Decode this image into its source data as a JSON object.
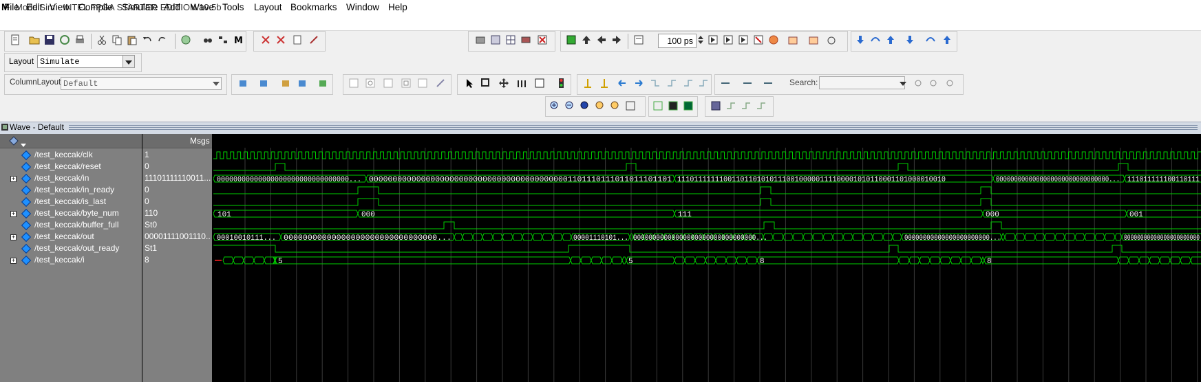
{
  "app": {
    "title": "ModelSim - INTEL FPGA STARTER EDITION 10.5b",
    "logo": "M"
  },
  "menu": [
    "File",
    "Edit",
    "View",
    "Compile",
    "Simulate",
    "Add",
    "Wave",
    "Tools",
    "Layout",
    "Bookmarks",
    "Window",
    "Help"
  ],
  "toolbar": {
    "time_value": "100 ps"
  },
  "layout": {
    "label": "Layout",
    "value": "Simulate"
  },
  "column_layout": {
    "label": "ColumnLayout",
    "value": "Default"
  },
  "search": {
    "label": "Search:"
  },
  "wave_window": {
    "title": "Wave - Default",
    "msgs_header": "Msgs"
  },
  "signals": [
    {
      "name": "/test_keccak/clk",
      "value": "1",
      "expandable": false
    },
    {
      "name": "/test_keccak/reset",
      "value": "0",
      "expandable": false
    },
    {
      "name": "/test_keccak/in",
      "value": "11101111110011...",
      "expandable": true
    },
    {
      "name": "/test_keccak/in_ready",
      "value": "0",
      "expandable": false
    },
    {
      "name": "/test_keccak/is_last",
      "value": "0",
      "expandable": false
    },
    {
      "name": "/test_keccak/byte_num",
      "value": "110",
      "expandable": true
    },
    {
      "name": "/test_keccak/buffer_full",
      "value": "St0",
      "expandable": false
    },
    {
      "name": "/test_keccak/out",
      "value": "00001111001110...",
      "expandable": true
    },
    {
      "name": "/test_keccak/out_ready",
      "value": "St1",
      "expandable": false
    },
    {
      "name": "/test_keccak/i",
      "value": "8",
      "expandable": true
    }
  ],
  "wave_labels": {
    "in": [
      "00000000000000000000000000000000...",
      "0000000000000000000000000000000000000000001101110111011011101101",
      "1110111111100110110101011100100000111100001010110001101000010010",
      "0000000000000000000000000000000...",
      "111011111100110111"
    ],
    "byte_num": [
      "101",
      "000",
      "111",
      "000",
      "001"
    ],
    "out": [
      "00010010111...",
      "00000000000000000000000000000000...",
      "00001110101...",
      "00000000000000000000000000000000...",
      "00000000000000000000000...",
      "00000000000000000000000"
    ],
    "i": [
      "5",
      "5",
      "8",
      "8"
    ]
  },
  "colors": {
    "wave": "#00d000",
    "background": "#000000",
    "cursor": "#ff2020"
  }
}
